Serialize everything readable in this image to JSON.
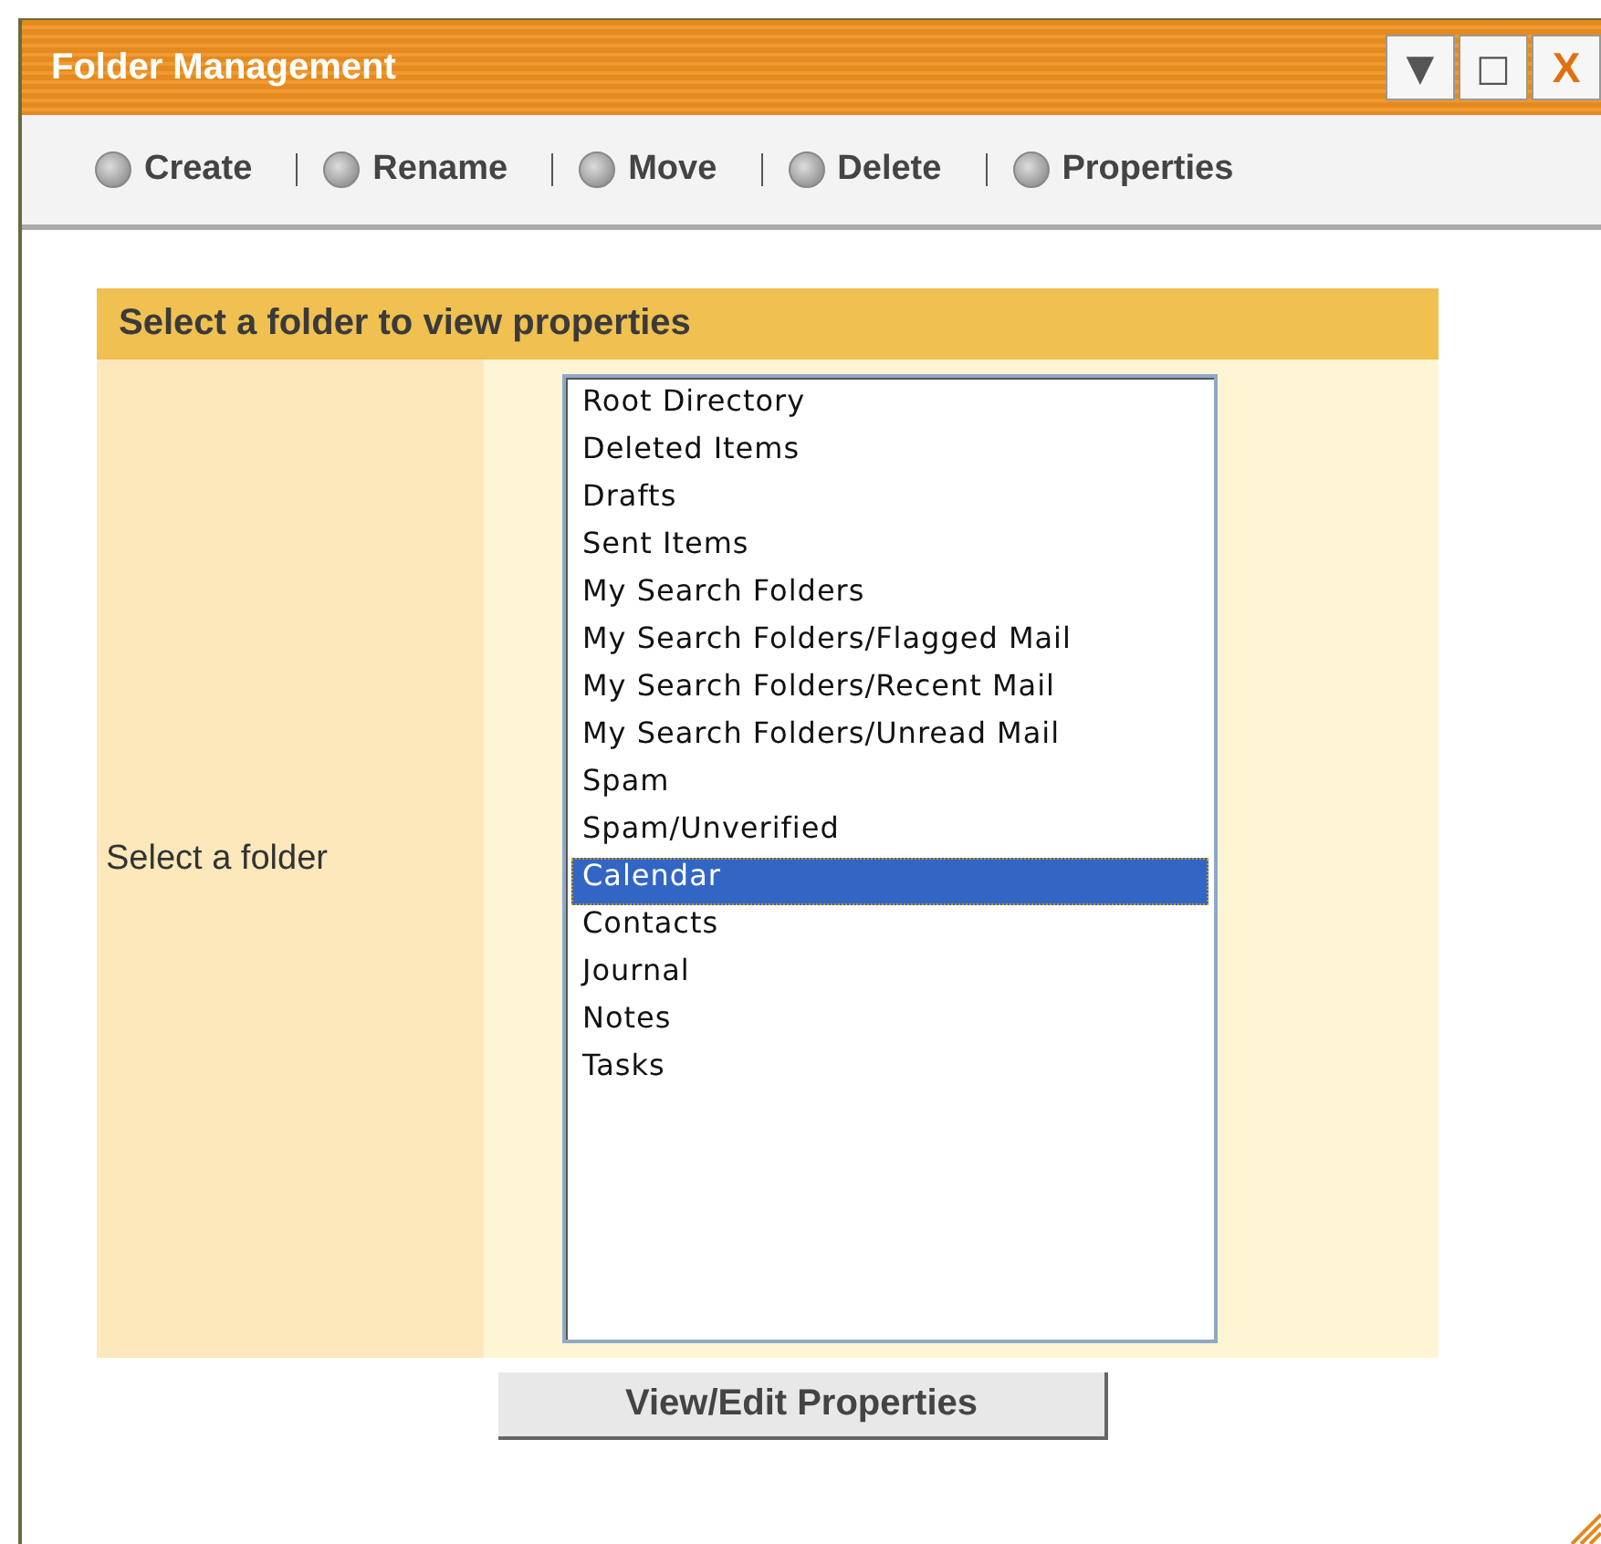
{
  "window": {
    "title": "Folder Management",
    "controls": [
      {
        "kind": "menu",
        "label": "▼"
      },
      {
        "kind": "maximize",
        "label": "□"
      },
      {
        "kind": "close",
        "label": "X"
      }
    ]
  },
  "toolbar": [
    {
      "label": "Create"
    },
    {
      "label": "Rename"
    },
    {
      "label": "Move"
    },
    {
      "label": "Delete"
    },
    {
      "label": "Properties"
    }
  ],
  "panel": {
    "header": "Select a folder to view properties",
    "field_label": "Select a folder",
    "folders": [
      {
        "name": "Root Directory",
        "selected": false
      },
      {
        "name": "Deleted Items",
        "selected": false
      },
      {
        "name": "Drafts",
        "selected": false
      },
      {
        "name": "Sent Items",
        "selected": false
      },
      {
        "name": "My Search Folders",
        "selected": false
      },
      {
        "name": "My Search Folders/Flagged Mail",
        "selected": false
      },
      {
        "name": "My Search Folders/Recent Mail",
        "selected": false
      },
      {
        "name": "My Search Folders/Unread Mail",
        "selected": false
      },
      {
        "name": "Spam",
        "selected": false
      },
      {
        "name": "Spam/Unverified",
        "selected": false
      },
      {
        "name": "Calendar",
        "selected": true
      },
      {
        "name": "Contacts",
        "selected": false
      },
      {
        "name": "Journal",
        "selected": false
      },
      {
        "name": "Notes",
        "selected": false
      },
      {
        "name": "Tasks",
        "selected": false
      }
    ]
  },
  "button": "View/Edit Properties"
}
